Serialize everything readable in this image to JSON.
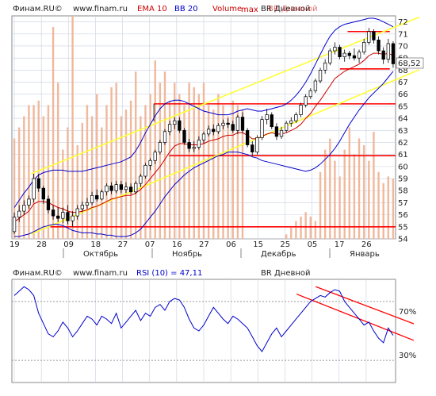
{
  "chart_data": [
    {
      "type": "candlestick",
      "header": {
        "source": "Финам.RU©",
        "site": "www.finam.ru",
        "ema": "EMA 10",
        "bb": "BB 20",
        "volume": "Volume",
        "vol_max": "max",
        "ticker": "BR Дневной",
        "ticker_overlay": "BR Дневной"
      },
      "colors": {
        "ema": "#cc0000",
        "bb": "#0000cc",
        "volume": "#cc0000",
        "volume_bars": "#f0b89c",
        "trend_lines": "#ffff33",
        "levels": "#ff0000",
        "grid": "#c8d0e0",
        "candle_outline": "#000000",
        "last_price_box": "#ffffff"
      },
      "y_axis": {
        "ylim": [
          54,
          72.5
        ],
        "ticks": [
          "54",
          "55",
          "56",
          "57",
          "58",
          "59",
          "60",
          "61",
          "62",
          "63",
          "64",
          "65",
          "66",
          "67",
          "68",
          "69",
          "70",
          "71",
          "72"
        ],
        "side": "right"
      },
      "x_axis": {
        "day_ticks": [
          "19",
          "28",
          "09",
          "18",
          "27",
          "07",
          "16",
          "27",
          "06",
          "15",
          "25",
          "05",
          "17",
          "26"
        ],
        "months": [
          "Октябрь",
          "Ноябрь",
          "Декабрь",
          "Январь"
        ]
      },
      "last_price": "68,52",
      "candles": [
        [
          54.6,
          56.2,
          54.4,
          55.8
        ],
        [
          55.8,
          56.8,
          55.4,
          56.3
        ],
        [
          56.3,
          57.2,
          56.0,
          56.8
        ],
        [
          56.8,
          57.6,
          56.5,
          57.3
        ],
        [
          57.3,
          59.4,
          57.0,
          59.0
        ],
        [
          59.0,
          59.4,
          57.9,
          58.2
        ],
        [
          58.2,
          58.4,
          56.9,
          57.3
        ],
        [
          57.3,
          57.6,
          56.1,
          56.4
        ],
        [
          56.4,
          56.8,
          55.6,
          55.9
        ],
        [
          55.9,
          56.6,
          55.4,
          55.7
        ],
        [
          55.7,
          56.6,
          55.3,
          56.2
        ],
        [
          56.2,
          56.8,
          55.2,
          55.5
        ],
        [
          55.5,
          56.3,
          55.0,
          55.9
        ],
        [
          55.9,
          56.8,
          55.6,
          56.5
        ],
        [
          56.5,
          57.1,
          56.2,
          56.8
        ],
        [
          56.8,
          57.4,
          56.5,
          57.0
        ],
        [
          57.0,
          57.9,
          56.8,
          57.6
        ],
        [
          57.6,
          58.1,
          57.1,
          57.3
        ],
        [
          57.3,
          58.1,
          57.2,
          57.9
        ],
        [
          57.9,
          58.6,
          57.6,
          58.4
        ],
        [
          58.4,
          58.7,
          57.7,
          58.0
        ],
        [
          58.0,
          58.8,
          57.8,
          58.5
        ],
        [
          58.5,
          58.8,
          57.8,
          58.1
        ],
        [
          58.1,
          58.7,
          57.8,
          58.3
        ],
        [
          58.3,
          58.6,
          57.7,
          57.9
        ],
        [
          57.9,
          58.8,
          57.7,
          58.6
        ],
        [
          58.6,
          59.4,
          58.3,
          59.2
        ],
        [
          59.2,
          60.3,
          59.0,
          60.1
        ],
        [
          60.1,
          60.7,
          59.7,
          60.5
        ],
        [
          60.5,
          61.4,
          60.2,
          61.2
        ],
        [
          61.2,
          62.2,
          61.0,
          62.0
        ],
        [
          62.0,
          63.1,
          61.8,
          62.9
        ],
        [
          62.9,
          63.8,
          62.6,
          63.5
        ],
        [
          63.5,
          64.1,
          63.1,
          63.8
        ],
        [
          63.8,
          64.1,
          62.8,
          63.0
        ],
        [
          63.0,
          63.2,
          61.8,
          62.0
        ],
        [
          62.0,
          62.3,
          61.2,
          61.5
        ],
        [
          61.5,
          62.1,
          61.2,
          61.6
        ],
        [
          61.6,
          62.5,
          61.4,
          62.2
        ],
        [
          62.2,
          62.9,
          61.9,
          62.7
        ],
        [
          62.7,
          63.4,
          62.5,
          63.1
        ],
        [
          63.1,
          63.5,
          62.6,
          62.9
        ],
        [
          62.9,
          63.6,
          62.7,
          63.4
        ],
        [
          63.4,
          63.9,
          63.1,
          63.6
        ],
        [
          63.6,
          64.0,
          63.2,
          63.5
        ],
        [
          63.5,
          63.8,
          62.8,
          63.0
        ],
        [
          63.0,
          64.3,
          62.7,
          64.1
        ],
        [
          64.1,
          64.5,
          62.8,
          63.0
        ],
        [
          63.0,
          63.2,
          61.6,
          61.8
        ],
        [
          61.8,
          62.1,
          60.9,
          61.2
        ],
        [
          61.2,
          62.6,
          61.0,
          62.4
        ],
        [
          62.4,
          64.2,
          62.2,
          63.9
        ],
        [
          63.9,
          64.8,
          63.5,
          64.3
        ],
        [
          64.3,
          64.5,
          63.1,
          63.3
        ],
        [
          63.3,
          63.6,
          62.2,
          62.5
        ],
        [
          62.5,
          63.3,
          62.3,
          63.0
        ],
        [
          63.0,
          63.8,
          62.8,
          63.6
        ],
        [
          63.6,
          64.1,
          63.3,
          63.8
        ],
        [
          63.8,
          64.5,
          63.6,
          64.3
        ],
        [
          64.3,
          65.3,
          64.1,
          65.1
        ],
        [
          65.1,
          66.0,
          64.9,
          65.8
        ],
        [
          65.8,
          66.5,
          65.6,
          66.3
        ],
        [
          66.3,
          67.3,
          66.1,
          67.1
        ],
        [
          67.1,
          68.2,
          66.9,
          68.0
        ],
        [
          68.0,
          68.9,
          67.7,
          68.6
        ],
        [
          68.6,
          69.8,
          68.4,
          69.6
        ],
        [
          69.6,
          70.3,
          69.3,
          69.9
        ],
        [
          69.9,
          70.1,
          68.9,
          69.1
        ],
        [
          69.1,
          69.7,
          68.7,
          69.4
        ],
        [
          69.4,
          69.6,
          68.9,
          69.2
        ],
        [
          69.2,
          69.8,
          68.8,
          69.0
        ],
        [
          69.0,
          69.7,
          68.6,
          69.5
        ],
        [
          69.5,
          70.6,
          69.3,
          70.3
        ],
        [
          70.3,
          71.5,
          70.1,
          71.2
        ],
        [
          71.2,
          71.4,
          70.2,
          70.5
        ],
        [
          70.5,
          70.8,
          69.3,
          69.6
        ],
        [
          69.6,
          69.9,
          68.5,
          68.9
        ],
        [
          68.9,
          70.6,
          68.6,
          70.2
        ],
        [
          70.2,
          70.4,
          68.2,
          68.52
        ]
      ],
      "ema_values": [
        55.4,
        55.7,
        56.0,
        56.3,
        56.9,
        57.1,
        57.1,
        57.0,
        56.8,
        56.6,
        56.5,
        56.3,
        56.2,
        56.2,
        56.3,
        56.4,
        56.6,
        56.7,
        56.9,
        57.1,
        57.3,
        57.4,
        57.5,
        57.6,
        57.6,
        57.8,
        58.1,
        58.5,
        59.0,
        59.5,
        60.0,
        60.6,
        61.2,
        61.7,
        61.9,
        61.9,
        61.8,
        61.8,
        61.8,
        61.9,
        62.1,
        62.2,
        62.3,
        62.5,
        62.6,
        62.6,
        62.8,
        62.8,
        62.6,
        62.3,
        62.3,
        62.5,
        62.7,
        62.8,
        62.7,
        62.7,
        62.8,
        63.0,
        63.2,
        63.5,
        64.0,
        64.4,
        65.0,
        65.5,
        66.1,
        66.7,
        67.3,
        67.6,
        67.9,
        68.1,
        68.3,
        68.5,
        68.8,
        69.2,
        69.4,
        69.4,
        69.3,
        69.4,
        69.2
      ],
      "bb_upper": [
        56.6,
        57.2,
        57.8,
        58.3,
        58.9,
        59.3,
        59.5,
        59.6,
        59.7,
        59.7,
        59.7,
        59.6,
        59.6,
        59.6,
        59.6,
        59.7,
        59.8,
        59.9,
        60.0,
        60.1,
        60.2,
        60.3,
        60.4,
        60.6,
        60.8,
        61.3,
        62.0,
        62.8,
        63.5,
        64.2,
        64.8,
        65.2,
        65.4,
        65.5,
        65.5,
        65.4,
        65.2,
        65.0,
        64.8,
        64.6,
        64.5,
        64.4,
        64.3,
        64.3,
        64.3,
        64.4,
        64.6,
        64.7,
        64.8,
        64.7,
        64.6,
        64.6,
        64.7,
        64.8,
        64.9,
        65.0,
        65.2,
        65.5,
        65.9,
        66.4,
        67.0,
        67.7,
        68.5,
        69.3,
        70.1,
        70.8,
        71.3,
        71.6,
        71.8,
        71.9,
        72.0,
        72.1,
        72.2,
        72.3,
        72.3,
        72.2,
        72.0,
        71.8,
        71.6
      ],
      "bb_lower": [
        54.2,
        54.2,
        54.3,
        54.4,
        54.6,
        54.8,
        55.0,
        55.1,
        55.2,
        55.2,
        55.1,
        54.9,
        54.7,
        54.6,
        54.5,
        54.5,
        54.5,
        54.4,
        54.4,
        54.3,
        54.3,
        54.2,
        54.2,
        54.2,
        54.3,
        54.5,
        54.8,
        55.3,
        55.8,
        56.3,
        56.9,
        57.5,
        58.0,
        58.5,
        58.9,
        59.3,
        59.6,
        59.9,
        60.1,
        60.3,
        60.5,
        60.7,
        60.9,
        61.0,
        61.2,
        61.2,
        61.2,
        61.1,
        61.0,
        60.8,
        60.7,
        60.5,
        60.4,
        60.3,
        60.2,
        60.1,
        60.0,
        59.9,
        59.8,
        59.7,
        59.6,
        59.7,
        59.9,
        60.2,
        60.6,
        61.0,
        61.5,
        62.1,
        62.8,
        63.5,
        64.1,
        64.7,
        65.2,
        65.7,
        66.1,
        66.5,
        66.9,
        67.4,
        67.9
      ],
      "volumes": [
        0.45,
        0.5,
        0.55,
        0.6,
        0.6,
        0.62,
        0.55,
        0.6,
        0.95,
        0.7,
        0.4,
        0.5,
        1.0,
        0.42,
        0.52,
        0.6,
        0.55,
        0.65,
        0.5,
        0.6,
        0.68,
        0.7,
        0.55,
        0.58,
        0.62,
        0.75,
        0.55,
        0.6,
        0.65,
        0.8,
        0.7,
        0.75,
        0.62,
        0.7,
        0.65,
        0.6,
        0.7,
        0.68,
        0.65,
        0.7,
        0.6,
        0.58,
        0.65,
        0.6,
        0.55,
        0.62,
        0.6,
        0.58,
        0.0,
        0.0,
        0.0,
        0.0,
        0.0,
        0.0,
        0.0,
        0.0,
        0.02,
        0.05,
        0.08,
        0.1,
        0.12,
        0.1,
        0.08,
        0.3,
        0.4,
        0.45,
        0.35,
        0.28,
        0.4,
        0.5,
        0.38,
        0.45,
        0.42,
        0.35,
        0.48,
        0.3,
        0.25,
        0.28,
        0.27
      ],
      "levels": [
        {
          "value": 65.2,
          "x_from": 0.37,
          "x_to": 1.0
        },
        {
          "value": 60.9,
          "x_from": 0.41,
          "x_to": 1.0
        },
        {
          "value": 55.0,
          "x_from": 0.1,
          "x_to": 1.0
        },
        {
          "value": 71.2,
          "x_from": 0.875,
          "x_to": 0.985
        },
        {
          "value": 68.1,
          "x_from": 0.855,
          "x_to": 0.985
        }
      ],
      "trend_lines": [
        {
          "from": [
            0.05,
            59.4
          ],
          "to": [
            1.0,
            71.6
          ]
        },
        {
          "from": [
            0.05,
            54.4
          ],
          "to": [
            1.0,
            67.2
          ]
        }
      ]
    },
    {
      "type": "line",
      "header": {
        "source": "Финам.RU©",
        "site": "www.finam.ru",
        "indicator": "RSI (10) = 47,11",
        "ticker": "BR Дневной"
      },
      "colors": {
        "line": "#0000cc",
        "levels": "#999999",
        "trend": "#ff0000",
        "grid": "#c8d0e0"
      },
      "y_axis": {
        "ylim": [
          15,
          85
        ],
        "level_labels": [
          "70%",
          "30%"
        ],
        "levels": [
          70,
          30
        ]
      },
      "values": [
        74,
        77,
        80,
        78,
        74,
        62,
        55,
        48,
        46,
        50,
        56,
        52,
        46,
        50,
        55,
        60,
        58,
        54,
        60,
        58,
        55,
        62,
        52,
        56,
        60,
        64,
        57,
        62,
        60,
        66,
        68,
        64,
        70,
        72,
        71,
        66,
        58,
        52,
        50,
        54,
        60,
        66,
        62,
        58,
        55,
        60,
        58,
        55,
        52,
        46,
        40,
        36,
        42,
        48,
        52,
        46,
        50,
        54,
        58,
        62,
        66,
        70,
        72,
        74,
        73,
        76,
        78,
        77,
        70,
        66,
        62,
        58,
        54,
        56,
        50,
        45,
        42,
        52,
        47
      ],
      "trend_lines": [
        {
          "from": [
            0.742,
            75
          ],
          "to": [
            0.985,
            50
          ]
        },
        {
          "from": [
            0.792,
            80
          ],
          "to": [
            0.985,
            61
          ]
        }
      ]
    }
  ]
}
